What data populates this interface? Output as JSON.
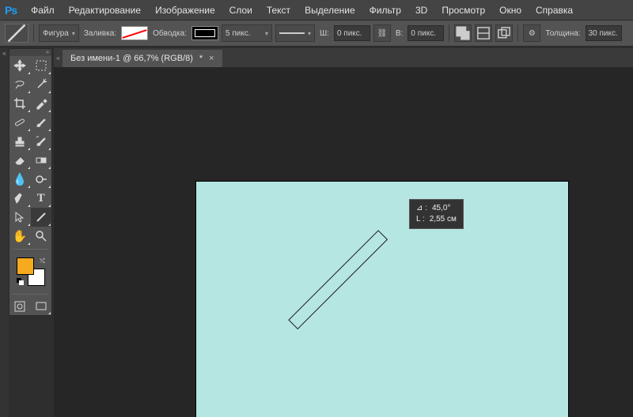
{
  "app": {
    "logo": "Ps"
  },
  "menu": [
    "Файл",
    "Редактирование",
    "Изображение",
    "Слои",
    "Текст",
    "Выделение",
    "Фильтр",
    "3D",
    "Просмотр",
    "Окно",
    "Справка"
  ],
  "options": {
    "mode_label": "Фигура",
    "fill_label": "Заливка:",
    "stroke_label": "Обводка:",
    "stroke_width": "5 пикс.",
    "width_label": "Ш:",
    "width_value": "0 пикс.",
    "height_label": "В:",
    "height_value": "0 пикс.",
    "weight_label": "Толщина:",
    "weight_value": "30 пикс."
  },
  "tab": {
    "title": "Без имени-1 @ 66,7% (RGB/8)",
    "modified": "*",
    "close": "×"
  },
  "tooltip": {
    "angle_label": "⊿ :",
    "angle_value": "45,0°",
    "length_label": "L :",
    "length_value": "2,55 см"
  },
  "colors": {
    "canvas": "#b5e6e2",
    "foreground": "#f6aa1e",
    "background": "#ffffff"
  }
}
